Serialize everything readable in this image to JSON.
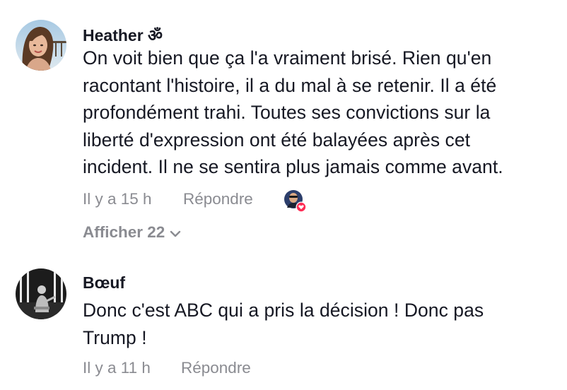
{
  "comments": [
    {
      "author": "Heather ॐ",
      "lines": [
        "On voit bien que ça l'a vraiment brisé. Rien qu'en",
        "racontant l'histoire, il a du mal à se retenir. Il a été",
        "profondément trahi. Toutes ses convictions sur la",
        "liberté d'expression ont été balayées après cet",
        "incident. Il ne se sentira plus jamais comme avant."
      ],
      "timestamp": "Il y a 15 h",
      "reply_label": "Répondre",
      "view_more": "Afficher 22"
    },
    {
      "author": "Bœuf",
      "lines": [
        "Donc c'est ABC qui a pris la décision ! Donc pas",
        "Trump !"
      ],
      "timestamp": "Il y a 11 h",
      "reply_label": "Répondre"
    }
  ],
  "colors": {
    "text": "#161823",
    "muted": "#8a8b91",
    "heart": "#fe2c55"
  },
  "icons": {
    "creator_liked": "creator-avatar-heart-icon",
    "expand": "chevron-down-icon"
  }
}
